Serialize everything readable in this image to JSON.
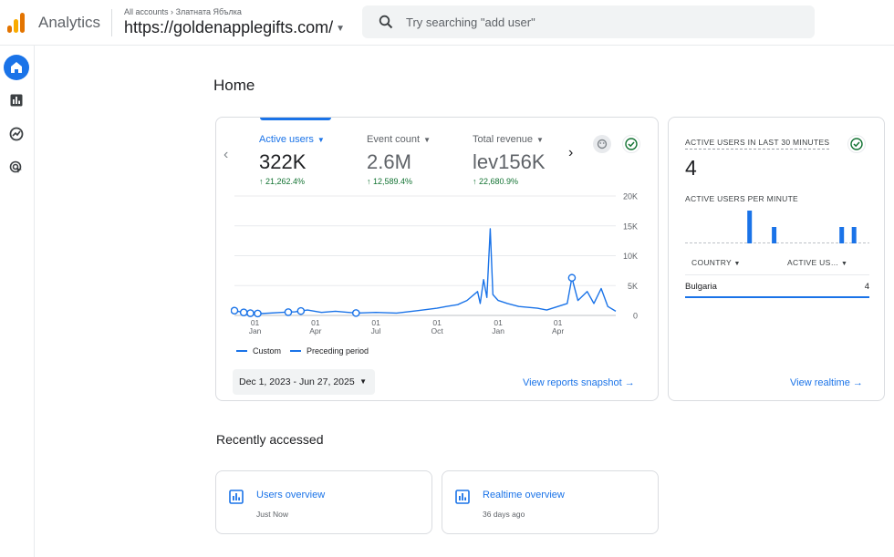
{
  "app": {
    "name": "Analytics"
  },
  "header": {
    "breadcrumb_root": "All accounts",
    "breadcrumb_sep": "›",
    "breadcrumb_account": "Златната Ябълка",
    "property_name": "https://goldenapplegifts.com/"
  },
  "search": {
    "placeholder": "Try searching \"add user\"",
    "value": ""
  },
  "sidebar": {
    "items": [
      "home-icon",
      "reports-icon",
      "explore-icon",
      "advertising-icon"
    ],
    "active": "home-icon"
  },
  "page": {
    "title": "Home"
  },
  "overview": {
    "metrics": [
      {
        "label": "Active users",
        "value": "322K",
        "change": "↑ 21,262.4%"
      },
      {
        "label": "Event count",
        "value": "2.6M",
        "change": "↑ 12,589.4%"
      },
      {
        "label": "Total revenue",
        "value": "lev156K",
        "change": "↑ 22,680.9%"
      }
    ],
    "legend_custom": "Custom",
    "legend_preceding": "Preceding period",
    "date_range": "Dec 1, 2023 - Jun 27, 2025",
    "view_snapshot": "View reports snapshot",
    "accent_color": "#1a73e8",
    "positive_color": "#137333"
  },
  "chart_data": {
    "type": "line",
    "title": "",
    "xlabel": "",
    "ylabel": "",
    "ylim": [
      0,
      20000
    ],
    "y_ticks": [
      "0",
      "5K",
      "10K",
      "15K",
      "20K"
    ],
    "x_ticks": [
      {
        "day": "01",
        "month": "Jan"
      },
      {
        "day": "01",
        "month": "Apr"
      },
      {
        "day": "01",
        "month": "Jul"
      },
      {
        "day": "01",
        "month": "Oct"
      },
      {
        "day": "01",
        "month": "Jan"
      },
      {
        "day": "01",
        "month": "Apr"
      }
    ],
    "x_range": [
      "2023-12-01",
      "2025-06-27"
    ],
    "series": [
      {
        "name": "Custom",
        "points": [
          [
            "2023-12-01",
            800
          ],
          [
            "2023-12-20",
            400
          ],
          [
            "2024-01-10",
            300
          ],
          [
            "2024-02-10",
            500
          ],
          [
            "2024-03-01",
            600
          ],
          [
            "2024-03-20",
            900
          ],
          [
            "2024-04-10",
            500
          ],
          [
            "2024-05-01",
            700
          ],
          [
            "2024-06-01",
            400
          ],
          [
            "2024-07-01",
            500
          ],
          [
            "2024-08-01",
            400
          ],
          [
            "2024-09-01",
            800
          ],
          [
            "2024-10-01",
            1200
          ],
          [
            "2024-10-15",
            1500
          ],
          [
            "2024-11-01",
            1800
          ],
          [
            "2024-11-15",
            2500
          ],
          [
            "2024-12-01",
            4000
          ],
          [
            "2024-12-05",
            2000
          ],
          [
            "2024-12-10",
            6000
          ],
          [
            "2024-12-15",
            3000
          ],
          [
            "2024-12-20",
            14500
          ],
          [
            "2024-12-24",
            3500
          ],
          [
            "2025-01-01",
            2500
          ],
          [
            "2025-01-15",
            2000
          ],
          [
            "2025-02-01",
            1500
          ],
          [
            "2025-03-01",
            1200
          ],
          [
            "2025-03-15",
            900
          ],
          [
            "2025-04-01",
            1500
          ],
          [
            "2025-04-15",
            2000
          ],
          [
            "2025-04-22",
            6300
          ],
          [
            "2025-05-01",
            2500
          ],
          [
            "2025-05-15",
            4000
          ],
          [
            "2025-05-25",
            2000
          ],
          [
            "2025-06-05",
            4500
          ],
          [
            "2025-06-15",
            1500
          ],
          [
            "2025-06-27",
            700
          ]
        ]
      }
    ],
    "annotations": [
      "2023-12-01",
      "2023-12-15",
      "2023-12-25",
      "2024-01-05",
      "2024-02-20",
      "2024-03-10",
      "2024-06-01",
      "2025-04-22"
    ]
  },
  "realtime": {
    "title": "ACTIVE USERS IN LAST 30 MINUTES",
    "count": "4",
    "per_minute_label": "ACTIVE USERS PER MINUTE",
    "per_minute_values": [
      0,
      0,
      0,
      0,
      0,
      0,
      0,
      0,
      0,
      0,
      2,
      0,
      0,
      0,
      1,
      0,
      0,
      0,
      0,
      0,
      0,
      0,
      0,
      0,
      0,
      1,
      0,
      1,
      0,
      0
    ],
    "col_country": "COUNTRY",
    "col_active": "ACTIVE US…",
    "rows": [
      {
        "country": "Bulgaria",
        "value": "4"
      }
    ],
    "view_realtime": "View realtime"
  },
  "recent": {
    "title": "Recently accessed",
    "items": [
      {
        "title": "Users overview",
        "subtitle": "Just Now"
      },
      {
        "title": "Realtime overview",
        "subtitle": "36 days ago"
      }
    ]
  }
}
